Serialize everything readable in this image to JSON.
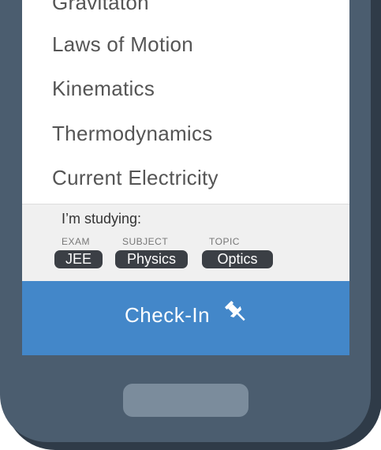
{
  "topics": [
    "Gravitaton",
    "Laws of Motion",
    "Kinematics",
    "Thermodynamics",
    "Current Electricity"
  ],
  "studying": {
    "heading": "I’m studying:",
    "exam": {
      "label": "EXAM",
      "value": "JEE"
    },
    "subject": {
      "label": "SUBJECT",
      "value": "Physics"
    },
    "topic": {
      "label": "TOPIC",
      "value": "Optics"
    }
  },
  "checkin": {
    "label": "Check-In",
    "icon": "pin-icon"
  },
  "colors": {
    "accent": "#4387c9",
    "phone_body": "#4b5d6f",
    "chip": "#3b3f45",
    "home_button": "#7b8c9c"
  }
}
